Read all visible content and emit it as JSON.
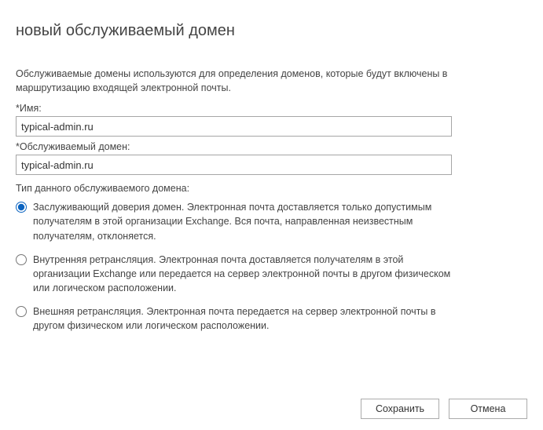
{
  "title": "новый обслуживаемый домен",
  "description": "Обслуживаемые домены используются для определения доменов, которые будут включены в маршрутизацию входящей электронной почты.",
  "fields": {
    "name": {
      "label": "*Имя:",
      "value": "typical-admin.ru"
    },
    "domain": {
      "label": "*Обслуживаемый домен:",
      "value": "typical-admin.ru"
    }
  },
  "domainType": {
    "label": "Тип данного обслуживаемого домена:",
    "options": [
      {
        "text": "Заслуживающий доверия домен. Электронная почта доставляется только допустимым получателям в этой организации Exchange. Вся почта, направленная неизвестным получателям, отклоняется.",
        "selected": true
      },
      {
        "text": "Внутренняя ретрансляция. Электронная почта доставляется получателям в этой организации Exchange или передается на сервер электронной почты в другом физическом или логическом расположении.",
        "selected": false
      },
      {
        "text": "Внешняя ретрансляция. Электронная почта передается на сервер электронной почты в другом физическом или логическом расположении.",
        "selected": false
      }
    ]
  },
  "buttons": {
    "save": "Сохранить",
    "cancel": "Отмена"
  }
}
